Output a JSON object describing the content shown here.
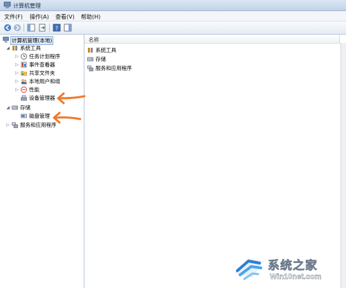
{
  "window": {
    "title": "计算机管理"
  },
  "menu": {
    "items": [
      "文件(F)",
      "操作(A)",
      "查看(V)",
      "帮助(H)"
    ]
  },
  "toolbar": {
    "buttons": [
      "back-icon",
      "forward-icon",
      "show-hide-tree-icon",
      "export-list-icon",
      "help-icon",
      "show-hide-action-pane-icon"
    ]
  },
  "tree": {
    "root": "计算机管理(本地)",
    "system_tools": "系统工具",
    "task_scheduler": "任务计划程序",
    "event_viewer": "事件查看器",
    "shared_folders": "共享文件夹",
    "local_users_groups": "本地用户和组",
    "performance": "性能",
    "device_manager": "设备管理器",
    "storage": "存储",
    "disk_management": "磁盘管理",
    "services_apps": "服务和应用程序"
  },
  "list": {
    "column_name": "名称",
    "items": [
      "系统工具",
      "存储",
      "服务和应用程序"
    ]
  },
  "annotations": {
    "arrow_color": "#f07a2c"
  },
  "watermark": {
    "brand": "系统之家",
    "url": "Win10net.com"
  }
}
